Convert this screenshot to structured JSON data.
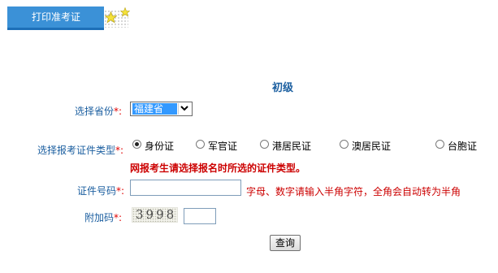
{
  "header": {
    "tab_label": "打印准考证"
  },
  "form": {
    "level_title": "初级",
    "province": {
      "label": "选择省份",
      "required_mark": "*:",
      "selected": "福建省"
    },
    "id_type": {
      "label": "选择报考证件类型",
      "required_mark": "*:",
      "options": [
        "身份证",
        "军官证",
        "港居民证",
        "澳居民证",
        "台胞证"
      ],
      "selected": "身份证"
    },
    "warning": "网报考生请选择报名时所选的证件类型。",
    "id_number": {
      "label": "证件号码",
      "required_mark": "*:",
      "value": "",
      "hint": "字母、数字请输入半角字符，全角会自动转为半角"
    },
    "captcha": {
      "label": "附加码",
      "required_mark": "*:",
      "image_text": "3998",
      "value": ""
    },
    "submit_label": "查询"
  },
  "colors": {
    "tab_blue": "#3b91d7",
    "label_blue": "#1c5fa0",
    "required_red": "#e00000",
    "select_highlight": "#3399ff"
  }
}
